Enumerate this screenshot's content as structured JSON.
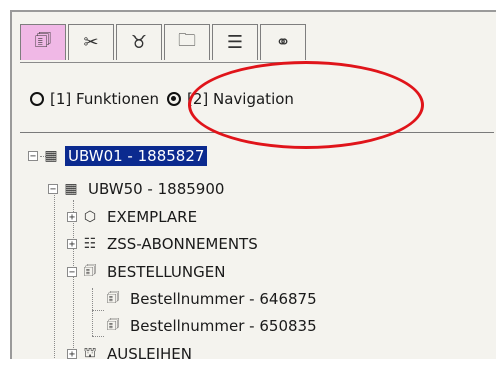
{
  "tabs": [
    {
      "icon": "document-icon",
      "glyph": "🗊",
      "active": true
    },
    {
      "icon": "scissors-icon",
      "glyph": "✂",
      "active": false
    },
    {
      "icon": "cup-icon",
      "glyph": "♉",
      "active": false
    },
    {
      "icon": "folder-icon",
      "glyph": "🗀",
      "active": false
    },
    {
      "icon": "stack-icon",
      "glyph": "☰",
      "active": false
    },
    {
      "icon": "binoculars-icon",
      "glyph": "⚭",
      "active": false
    }
  ],
  "radios": [
    {
      "label": "[1] Funktionen",
      "checked": false
    },
    {
      "label": "[2] Navigation",
      "checked": true
    }
  ],
  "tree": [
    {
      "label": "UBW01 - 1885827",
      "selected": true
    },
    {
      "label": "UBW50 - 1885900",
      "selected": false
    },
    {
      "label": "EXEMPLARE",
      "selected": false
    },
    {
      "label": "ZSS-ABONNEMENTS",
      "selected": false
    },
    {
      "label": "BESTELLUNGEN",
      "selected": false
    },
    {
      "label": "Bestellnummer - 646875",
      "selected": false
    },
    {
      "label": "Bestellnummer - 650835",
      "selected": false
    },
    {
      "label": "AUSLEIHEN",
      "selected": false
    }
  ],
  "highlight_color": "#e0141a",
  "selection_color": "#0b2a8f",
  "active_tab_color": "#f0b8e6"
}
